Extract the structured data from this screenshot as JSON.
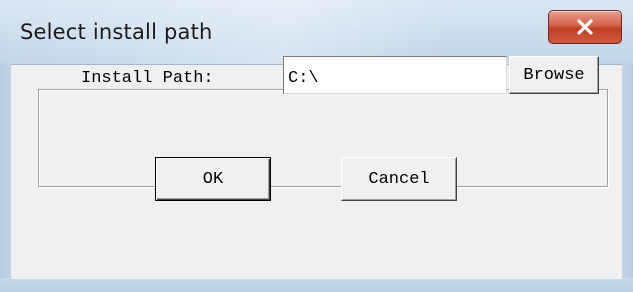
{
  "window": {
    "title": "Select install path"
  },
  "form": {
    "path_label": "Install Path:",
    "path_value": "C:\\",
    "browse_label": "Browse"
  },
  "buttons": {
    "ok_label": "OK",
    "cancel_label": "Cancel"
  },
  "icons": {
    "close": "close-icon"
  },
  "colors": {
    "close_button": "#c13d25",
    "client_background": "#f0f0f0",
    "frame": "#c6d7e8"
  }
}
